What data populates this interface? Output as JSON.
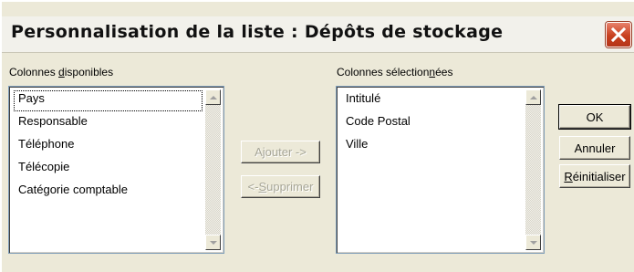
{
  "dialog": {
    "title": "Personnalisation de la liste : Dépôts de stockage"
  },
  "available": {
    "label_pre": "Colonnes ",
    "label_mnemonic": "d",
    "label_post": "isponibles",
    "items": [
      "Pays",
      "Responsable",
      "Téléphone",
      "Télécopie",
      "Catégorie comptable"
    ]
  },
  "selected": {
    "label_pre": "Colonnes sélection",
    "label_mnemonic": "n",
    "label_post": "ées",
    "items": [
      "Intitulé",
      "Code Postal",
      "Ville"
    ]
  },
  "buttons": {
    "add": "Ajouter ->",
    "remove_pre": "<- ",
    "remove_mnemonic": "S",
    "remove_post": "upprimer",
    "ok": "OK",
    "cancel": "Annuler",
    "reset_mnemonic": "R",
    "reset_post": "éinitialiser"
  },
  "colors": {
    "dialog_bg": "#ece9d8",
    "close_button": "#c8401f",
    "list_border": "#7f9db9"
  }
}
